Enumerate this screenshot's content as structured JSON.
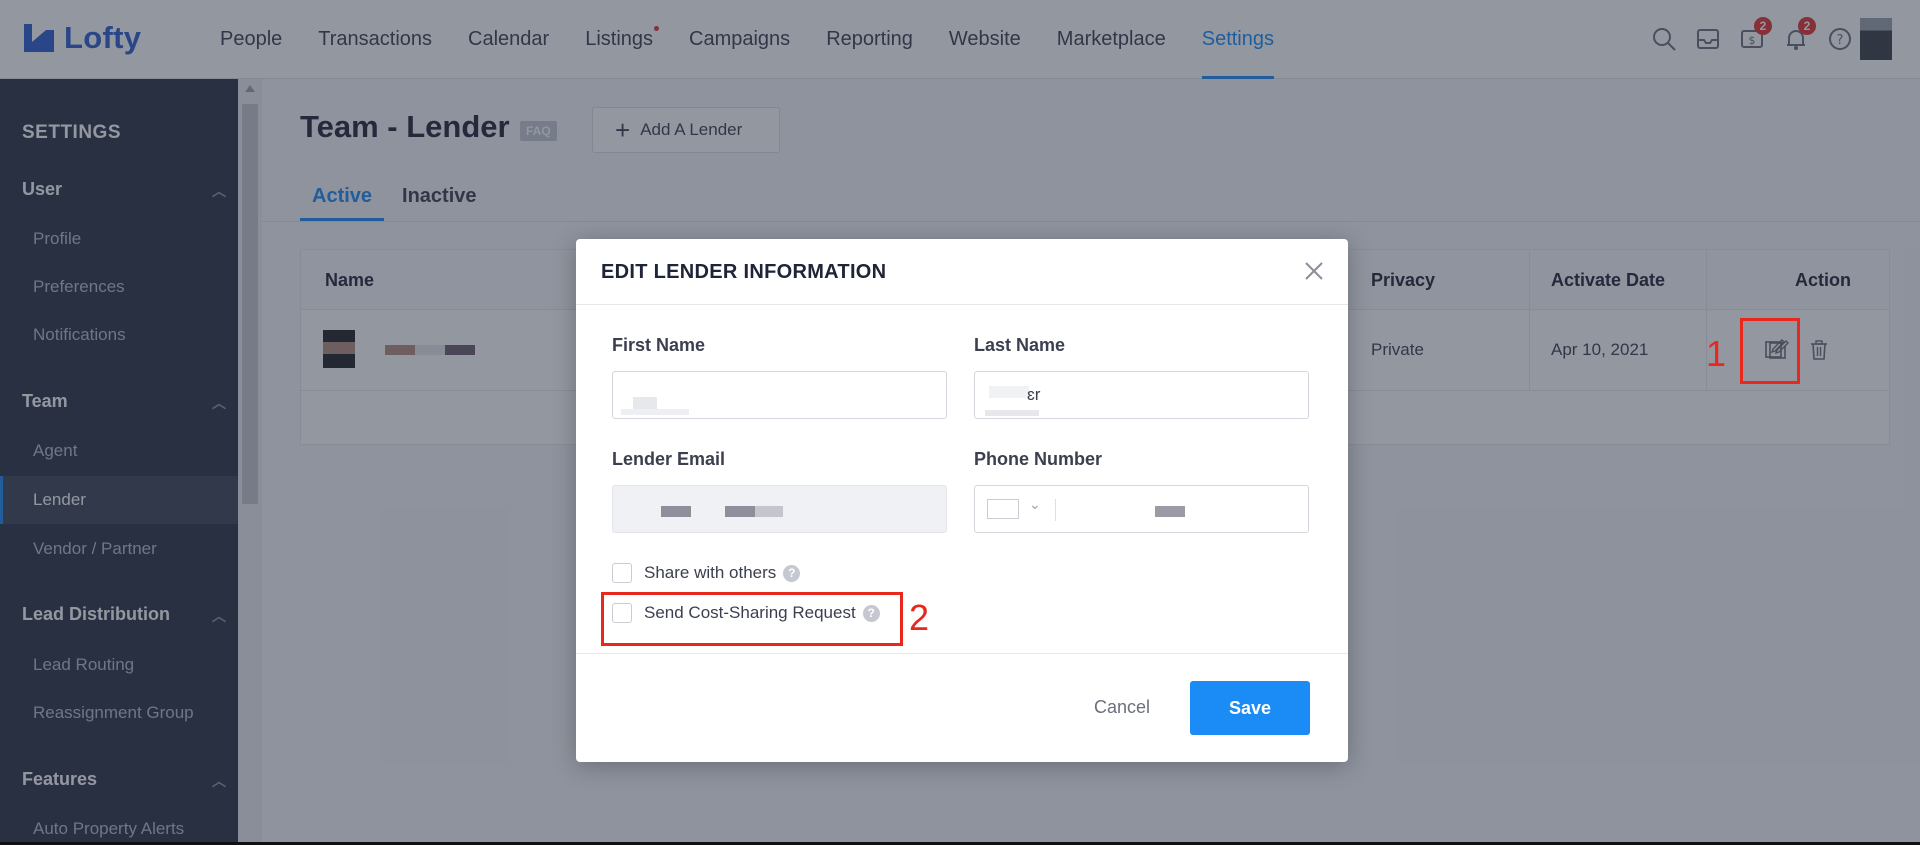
{
  "app": {
    "logo_text": "Lofty",
    "brand_color": "#2a5cce",
    "accent_color": "#1b8bf5"
  },
  "nav": {
    "items": [
      {
        "label": "People"
      },
      {
        "label": "Transactions"
      },
      {
        "label": "Calendar"
      },
      {
        "label": "Listings",
        "dot": true
      },
      {
        "label": "Campaigns"
      },
      {
        "label": "Reporting"
      },
      {
        "label": "Website"
      },
      {
        "label": "Marketplace"
      },
      {
        "label": "Settings",
        "active": true
      }
    ],
    "icons": [
      {
        "name": "search-icon"
      },
      {
        "name": "inbox-icon"
      },
      {
        "name": "billing-icon",
        "badge": "2"
      },
      {
        "name": "bell-icon",
        "badge": "2"
      },
      {
        "name": "help-icon"
      }
    ]
  },
  "sidebar": {
    "title": "SETTINGS",
    "groups": [
      {
        "label": "User",
        "items": [
          "Profile",
          "Preferences",
          "Notifications"
        ]
      },
      {
        "label": "Team",
        "items": [
          "Agent",
          "Lender",
          "Vendor / Partner"
        ]
      },
      {
        "label": "Lead Distribution",
        "items": [
          "Lead Routing",
          "Reassignment Group"
        ]
      },
      {
        "label": "Features",
        "items": [
          "Auto Property Alerts"
        ]
      }
    ],
    "active_item": "Lender"
  },
  "page": {
    "title": "Team - Lender",
    "faq_badge": "FAQ",
    "add_button": "Add A Lender",
    "tabs": [
      {
        "label": "Active",
        "active": true
      },
      {
        "label": "Inactive"
      }
    ]
  },
  "table": {
    "headers": {
      "name": "Name",
      "privacy": "Privacy",
      "activate_date": "Activate Date",
      "action": "Action"
    },
    "rows": [
      {
        "privacy": "Private",
        "activate_date": "Apr 10, 2021"
      }
    ]
  },
  "modal": {
    "title": "EDIT LENDER INFORMATION",
    "first_name_label": "First Name",
    "last_name_label": "Last Name",
    "last_name_visible": "ɛr",
    "email_label": "Lender Email",
    "phone_label": "Phone Number",
    "share_label": "Share with others",
    "cost_sharing_label": "Send Cost-Sharing Request",
    "cancel": "Cancel",
    "save": "Save"
  },
  "annotations": {
    "step1": "1",
    "step2": "2",
    "color": "#e8271d"
  }
}
